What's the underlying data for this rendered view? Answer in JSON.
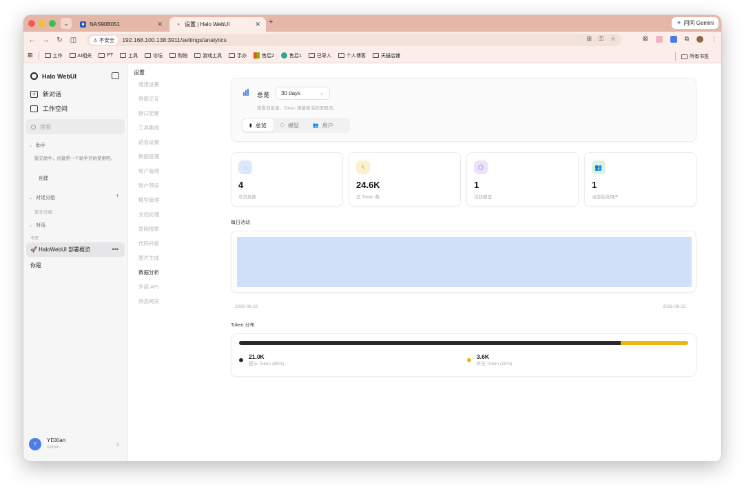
{
  "browser": {
    "tabs": [
      {
        "label": "NAS90B051",
        "active": false
      },
      {
        "label": "设置 | Halo WebUI",
        "active": true
      }
    ],
    "new_tab": "+",
    "gemini_label": "问问 Gemini",
    "insecure_label": "不安全",
    "url": "192.168.100.138:3911/settings/analytics",
    "bookmarks": [
      "工作",
      "AI相关",
      "PT",
      "工具",
      "论坛",
      "购物",
      "游戏工具",
      "手办",
      "售后2",
      "售后1",
      "已导入",
      "个人博客",
      "天猫店铺"
    ],
    "all_bookmarks": "所有书签"
  },
  "sidebar": {
    "brand": "Halo WebUI",
    "new_chat": "新对话",
    "workspace": "工作空间",
    "search_placeholder": "搜索",
    "assistant_section": "助手",
    "assistant_hint": "暂无助手，创建第一个助手开始使用吧。",
    "create_label": "创建",
    "groups_section": "对话分组",
    "groups_plus": "+",
    "no_groups": "暂无分组",
    "conversations_section": "对话",
    "today_label": "今天",
    "active_conversation": "🚀 HaloWebUI 部署概览",
    "active_dots": "•••",
    "conversation_2": "你是",
    "user_initial": "Y",
    "user_name": "YDXian",
    "user_role": "Admin"
  },
  "settings_nav": {
    "title": "设置",
    "items": [
      "通用设置",
      "界面交互",
      "接口配置",
      "工具集成",
      "语音设置",
      "数据管理",
      "账户管理",
      "账户预设",
      "模型管理",
      "文档处理",
      "联网搜索",
      "代码升级",
      "图片生成",
      "数据分析",
      "外部 API",
      "消息网关"
    ],
    "active_index": 13
  },
  "overview": {
    "title": "总览",
    "range": "30 days",
    "subtitle": "查看消息量、Token 用量和活跃度概况。",
    "tabs": [
      {
        "label": "总览",
        "icon": "bar-chart-icon",
        "active": true
      },
      {
        "label": "模型",
        "icon": "cube-icon",
        "active": false
      },
      {
        "label": "用户",
        "icon": "users-icon",
        "active": false
      }
    ]
  },
  "stats": [
    {
      "value": "4",
      "label": "总消息数",
      "icon": "message-icon",
      "color": "#dce8fb",
      "icon_color": "#4a7ae8"
    },
    {
      "value": "24.6K",
      "label": "总 Token 数",
      "icon": "bolt-icon",
      "color": "#fbf0cf",
      "icon_color": "#d9a30a"
    },
    {
      "value": "1",
      "label": "活跃模型",
      "icon": "cube-icon",
      "color": "#ece3fb",
      "icon_color": "#8a5ad8"
    },
    {
      "value": "1",
      "label": "当前在线用户",
      "icon": "users-icon",
      "color": "#daf3e1",
      "icon_color": "#2f9a55"
    }
  ],
  "daily_activity": {
    "title": "每日活动",
    "start_date": "2026-06-22",
    "end_date": "2026-06-22",
    "fill_color": "#cfe0f8"
  },
  "token_distribution": {
    "title": "Token 分布",
    "segments": [
      {
        "value": "21.0K",
        "label": "提示 Token (85%)",
        "fraction": 0.85,
        "color": "#2a2a2a"
      },
      {
        "value": "3.6K",
        "label": "补全 Token (15%)",
        "fraction": 0.15,
        "color": "#eab516"
      }
    ]
  }
}
